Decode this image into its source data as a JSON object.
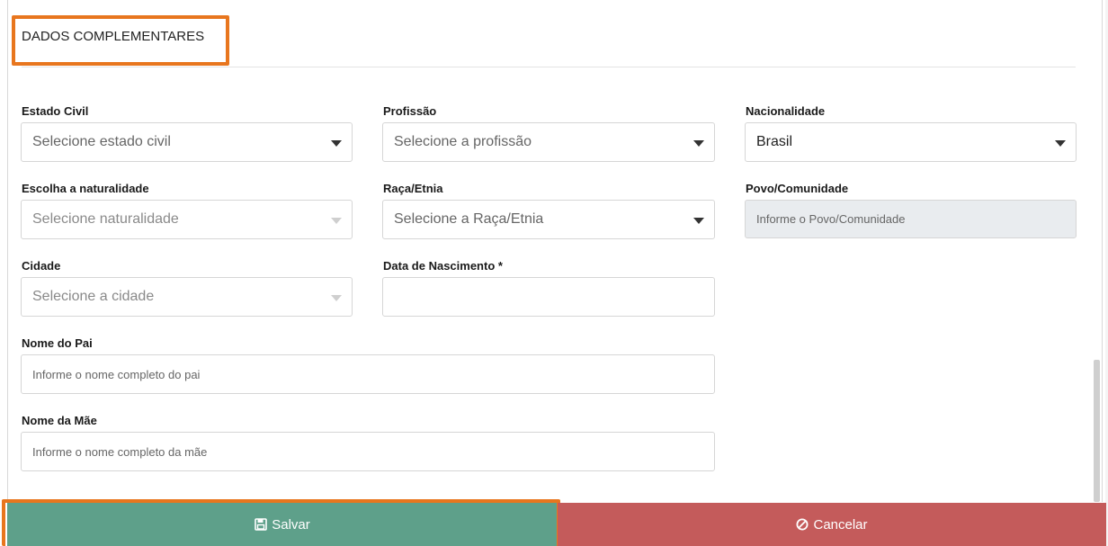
{
  "section": {
    "title": "DADOS COMPLEMENTARES"
  },
  "fields": {
    "estado_civil": {
      "label": "Estado Civil",
      "value": "Selecione estado civil"
    },
    "profissao": {
      "label": "Profissão",
      "value": "Selecione a profissão"
    },
    "nacionalidade": {
      "label": "Nacionalidade",
      "value": "Brasil"
    },
    "naturalidade": {
      "label": "Escolha a naturalidade",
      "value": "Selecione naturalidade"
    },
    "raca_etnia": {
      "label": "Raça/Etnia",
      "value": "Selecione a Raça/Etnia"
    },
    "povo_comunidade": {
      "label": "Povo/Comunidade",
      "placeholder": "Informe o Povo/Comunidade"
    },
    "cidade": {
      "label": "Cidade",
      "value": "Selecione a cidade"
    },
    "data_nascimento": {
      "label": "Data de Nascimento *",
      "value": ""
    },
    "nome_pai": {
      "label": "Nome do Pai",
      "placeholder": "Informe o nome completo do pai"
    },
    "nome_mae": {
      "label": "Nome da Mãe",
      "placeholder": "Informe o nome completo da mãe"
    }
  },
  "buttons": {
    "save": {
      "label": "Salvar",
      "icon": "floppy-disk-icon",
      "color": "#5ea08a"
    },
    "cancel": {
      "label": "Cancelar",
      "icon": "ban-icon",
      "color": "#c45b5b"
    }
  },
  "highlight_color": "#e8761e"
}
